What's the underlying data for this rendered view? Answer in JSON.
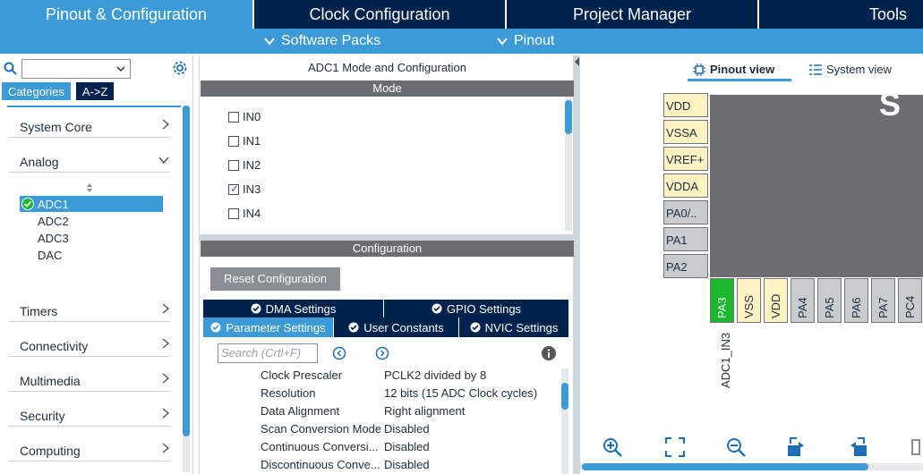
{
  "top_tabs": [
    {
      "label": "Pinout & Configuration",
      "active": true
    },
    {
      "label": "Clock Configuration",
      "active": false
    },
    {
      "label": "Project Manager",
      "active": false
    },
    {
      "label": "Tools",
      "active": false
    }
  ],
  "sub_menu": {
    "software_packs": "Software Packs",
    "pinout": "Pinout"
  },
  "left_panel": {
    "search_value": "",
    "category_tabs": [
      "Categories",
      "A->Z"
    ],
    "categories": [
      "System Core",
      "Analog",
      "Timers",
      "Connectivity",
      "Multimedia",
      "Security",
      "Computing"
    ],
    "analog_items": [
      "ADC1",
      "ADC2",
      "ADC3",
      "DAC"
    ]
  },
  "middle_panel": {
    "title": "ADC1 Mode and Configuration",
    "mode_header": "Mode",
    "mode_items": [
      {
        "label": "IN0",
        "checked": false
      },
      {
        "label": "IN1",
        "checked": false
      },
      {
        "label": "IN2",
        "checked": false
      },
      {
        "label": "IN3",
        "checked": true
      },
      {
        "label": "IN4",
        "checked": false
      }
    ],
    "configuration_header": "Configuration",
    "reset_label": "Reset Configuration",
    "tabs_row1": [
      "DMA Settings",
      "GPIO Settings"
    ],
    "tabs_row2": [
      "Parameter Settings",
      "User Constants",
      "NVIC Settings"
    ],
    "search_placeholder": "Search (Crtl+F)",
    "params": [
      {
        "key": "Clock Prescaler",
        "value": "PCLK2 divided by 8"
      },
      {
        "key": "Resolution",
        "value": "12 bits (15 ADC Clock cycles)"
      },
      {
        "key": "Data Alignment",
        "value": "Right alignment"
      },
      {
        "key": "Scan Conversion Mode",
        "value": "Disabled"
      },
      {
        "key": "Continuous Conversi...",
        "value": "Disabled"
      },
      {
        "key": "Discontinuous Conve...",
        "value": "Disabled"
      }
    ]
  },
  "right_panel": {
    "view_tabs": {
      "pinout": "Pinout view",
      "system": "System view"
    },
    "chip_text": "S",
    "left_pins": [
      {
        "label": "VDD",
        "color": "#fff3c4"
      },
      {
        "label": "VSSA",
        "color": "#fff3c4"
      },
      {
        "label": "VREF+",
        "color": "#fff3c4"
      },
      {
        "label": "VDDA",
        "color": "#fff3c4"
      },
      {
        "label": "PA0/..",
        "color": "#c9ccce"
      },
      {
        "label": "PA1",
        "color": "#c9ccce"
      },
      {
        "label": "PA2",
        "color": "#c9ccce"
      }
    ],
    "bottom_pins": [
      {
        "label": "PA3",
        "color": "#19b82f"
      },
      {
        "label": "VSS",
        "color": "#fff3c4"
      },
      {
        "label": "VDD",
        "color": "#fff3c4"
      },
      {
        "label": "PA4",
        "color": "#c9ccce"
      },
      {
        "label": "PA5",
        "color": "#c9ccce"
      },
      {
        "label": "PA6",
        "color": "#c9ccce"
      },
      {
        "label": "PA7",
        "color": "#c9ccce"
      },
      {
        "label": "PC4",
        "color": "#c9ccce"
      }
    ],
    "pin_signal": "ADC1_IN3"
  },
  "colors": {
    "navy": "#00234d",
    "accent": "#3c9ad6",
    "gray_bar": "#6b6e70",
    "green_check": "#19b82f"
  }
}
